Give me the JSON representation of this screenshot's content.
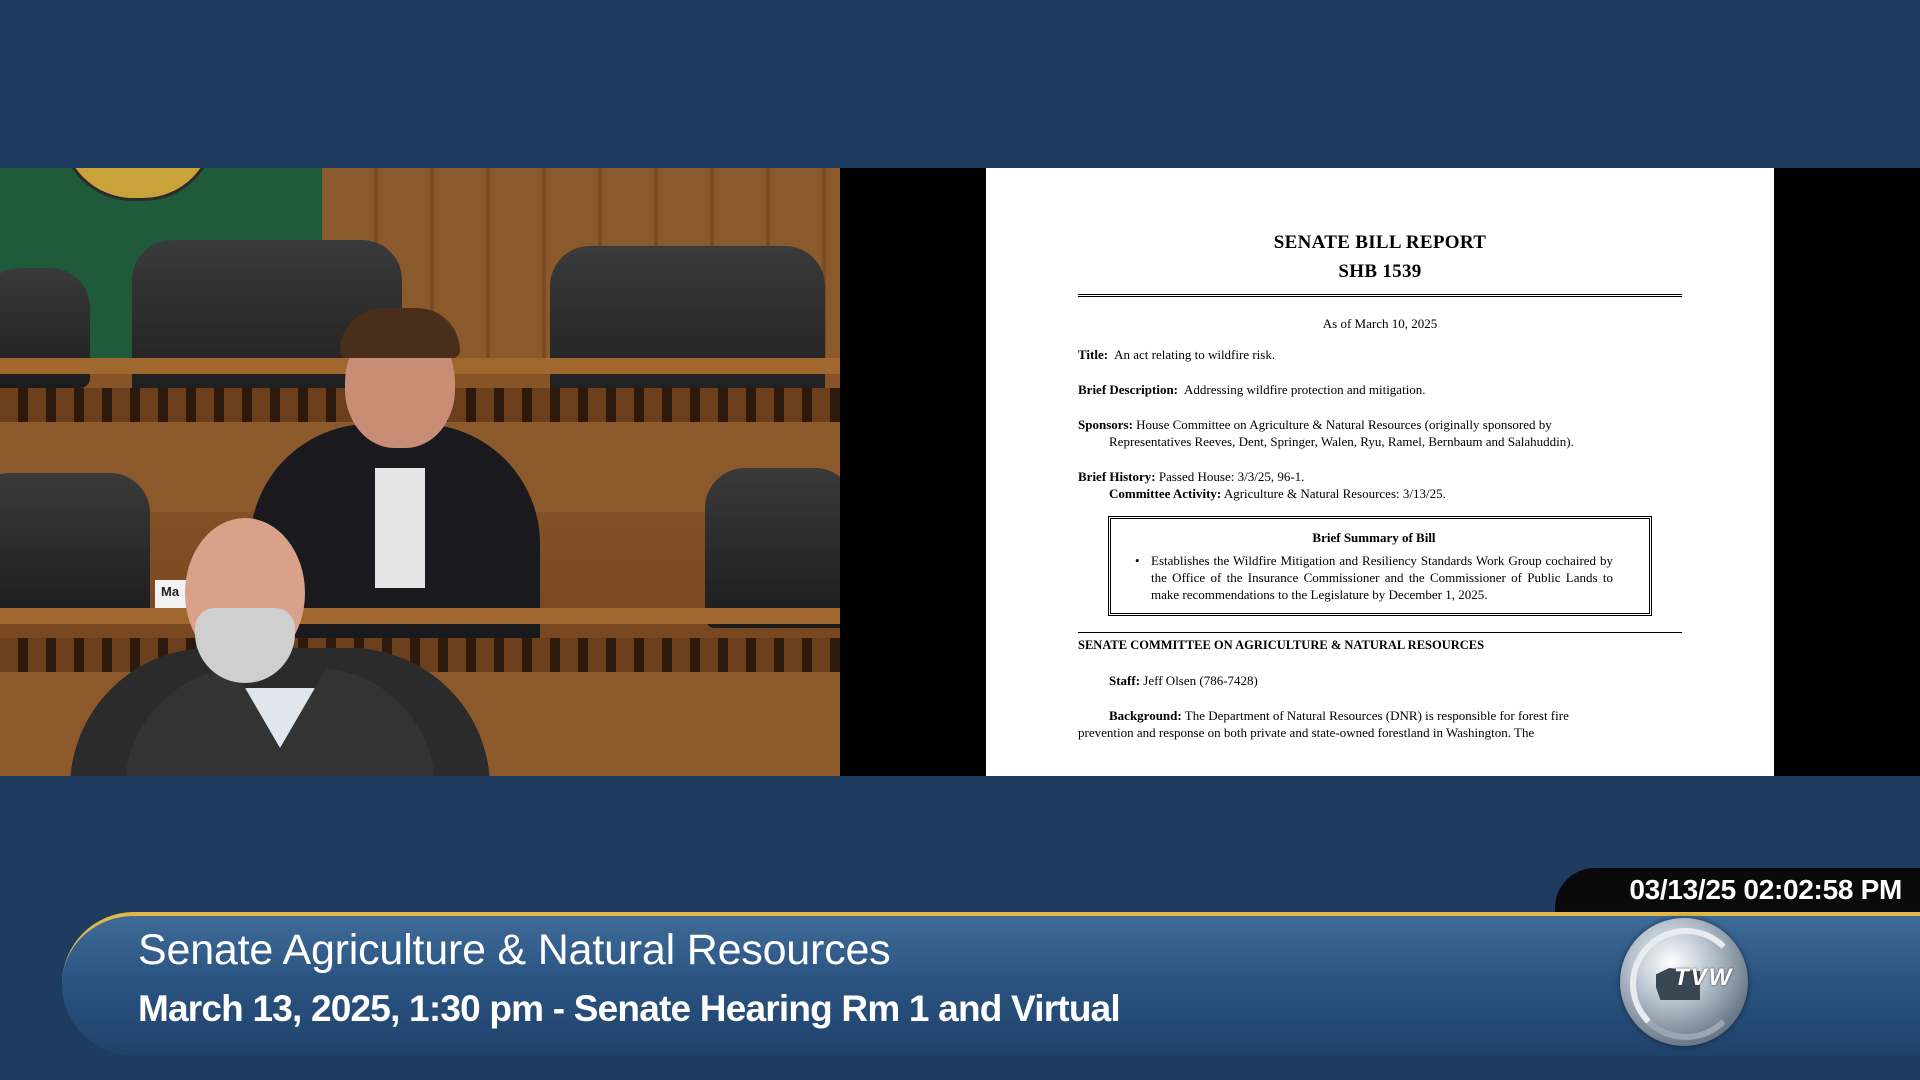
{
  "broadcast": {
    "timestamp": "03/13/25 02:02:58 PM",
    "lower_third": {
      "title": "Senate Agriculture & Natural Resources",
      "subtitle": "March 13, 2025, 1:30 pm - Senate Hearing Rm 1 and Virtual"
    },
    "logo": {
      "text": "TVW"
    },
    "camera": {
      "nameplate": "Ma"
    }
  },
  "document": {
    "title_line1": "SENATE BILL REPORT",
    "title_line2": "SHB 1539",
    "as_of": "As of March 10, 2025",
    "title_label": "Title:",
    "title_value": "An act relating to wildfire risk.",
    "brief_desc_label": "Brief Description:",
    "brief_desc_value": "Addressing wildfire protection and mitigation.",
    "sponsors_label": "Sponsors:",
    "sponsors_value_1": "House Committee on Agriculture & Natural Resources (originally sponsored by",
    "sponsors_value_2": "Representatives Reeves, Dent, Springer, Walen, Ryu, Ramel, Bernbaum and Salahuddin).",
    "history_label": "Brief History:",
    "history_value": "Passed House: 3/3/25, 96-1.",
    "committee_activity_label": "Committee Activity:",
    "committee_activity_value": "Agriculture & Natural Resources: 3/13/25.",
    "summary_heading": "Brief Summary of Bill",
    "summary_text": "Establishes the Wildfire Mitigation and Resiliency Standards Work Group cochaired by the Office of the Insurance Commissioner and the Commissioner of Public Lands to make recommendations to the Legislature by December 1, 2025.",
    "committee_heading": "SENATE COMMITTEE ON AGRICULTURE & NATURAL RESOURCES",
    "staff_label": "Staff:",
    "staff_value": "Jeff Olsen (786-7428)",
    "background_label": "Background:",
    "background_text_1": "The Department of Natural Resources (DNR) is responsible for forest fire",
    "background_text_2": "prevention and response on both private and state-owned forestland in Washington.  The"
  }
}
